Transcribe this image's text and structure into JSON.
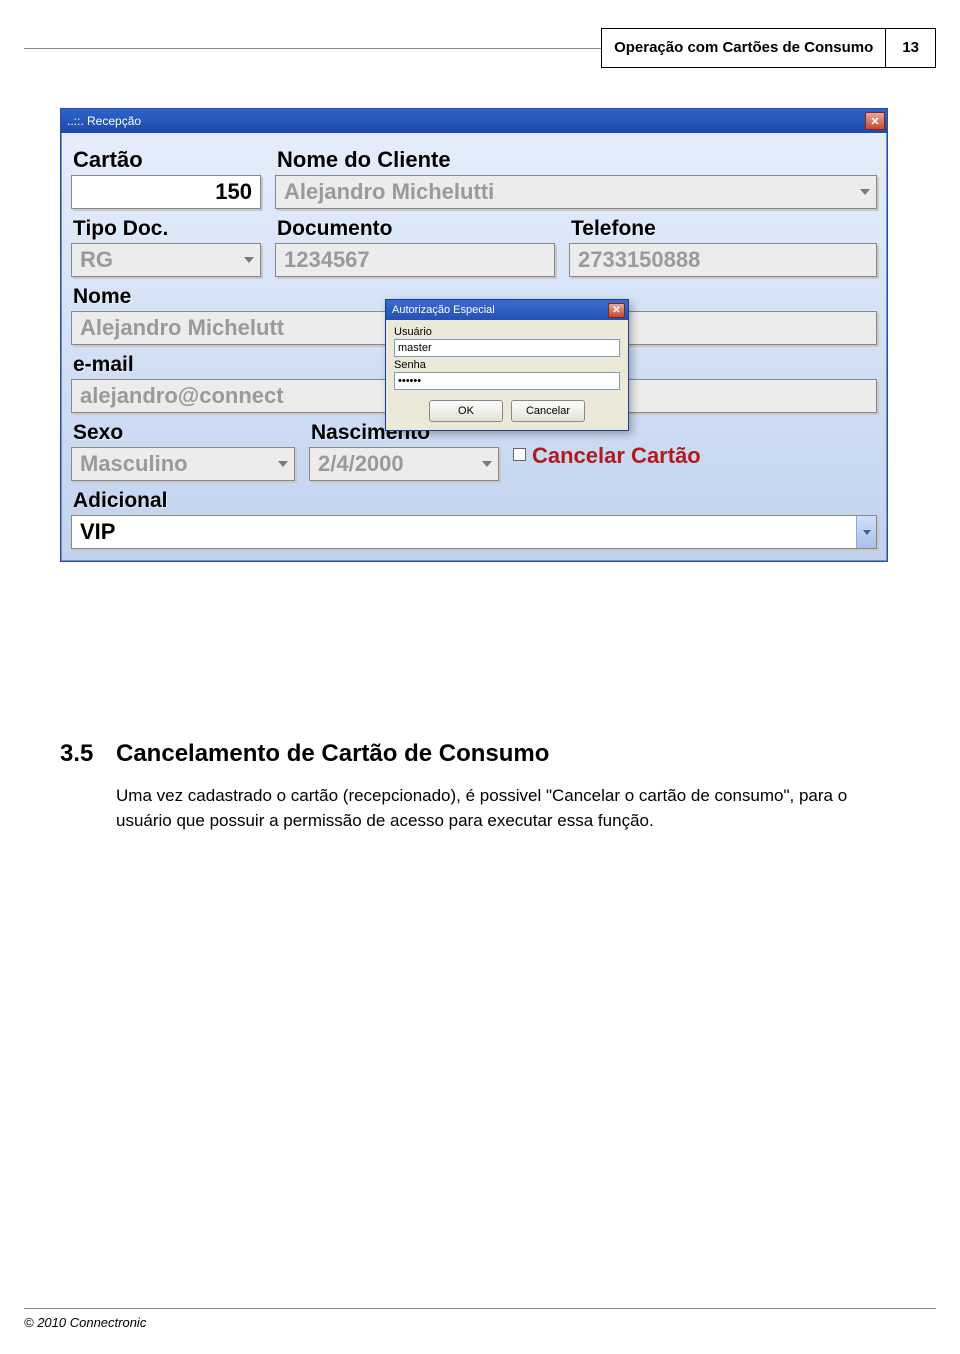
{
  "header": {
    "title": "Operação com Cartões de Consumo",
    "page_number": "13"
  },
  "window": {
    "title": "..::.  Recepção",
    "labels": {
      "cartao": "Cartão",
      "nome_cliente": "Nome do Cliente",
      "tipo_doc": "Tipo Doc.",
      "documento": "Documento",
      "telefone": "Telefone",
      "nome": "Nome",
      "email": "e-mail",
      "sexo": "Sexo",
      "nascimento": "Nascimento",
      "adicional": "Adicional"
    },
    "values": {
      "cartao": "150",
      "nome_cliente": "Alejandro Michelutti",
      "tipo_doc": "RG",
      "documento": "1234567",
      "telefone": "2733150888",
      "nome": "Alejandro Michelutt",
      "email": "alejandro@connect",
      "sexo": "Masculino",
      "nascimento": "2/4/2000",
      "adicional": "VIP"
    },
    "cancel_label": "Cancelar Cartão"
  },
  "auth_dialog": {
    "title": "Autorização Especial",
    "usuario_label": "Usuário",
    "usuario_value": "master",
    "senha_label": "Senha",
    "senha_value": "******",
    "ok_label": "OK",
    "cancel_label": "Cancelar"
  },
  "section": {
    "number": "3.5",
    "title": "Cancelamento de Cartão de Consumo",
    "paragraph": "Uma vez cadastrado o cartão (recepcionado), é possivel \"Cancelar o cartão de consumo\", para o usuário que possuir a permissão de acesso para executar essa função."
  },
  "footer": {
    "copyright": "© 2010 Connectronic"
  }
}
